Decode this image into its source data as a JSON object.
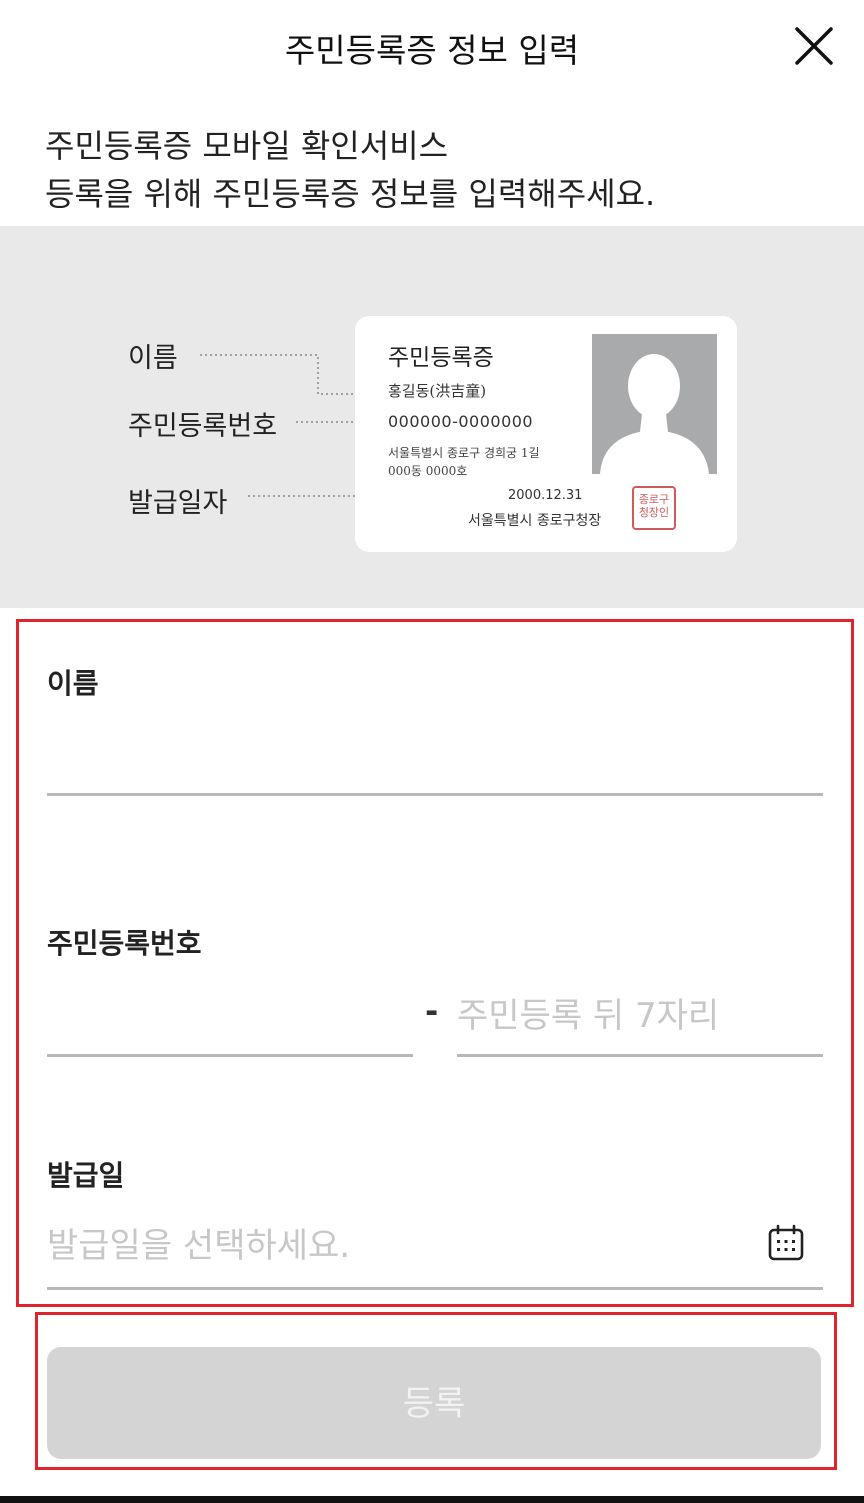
{
  "header": {
    "title": "주민등록증 정보 입력",
    "close_icon": "close-icon"
  },
  "intro": {
    "line1": "주민등록증 모바일 확인서비스",
    "line2": "등록을 위해 주민등록증 정보를 입력해주세요."
  },
  "illustration": {
    "labels": {
      "name": "이름",
      "rrn": "주민등록번호",
      "issue_date": "발급일자"
    },
    "card": {
      "title": "주민등록증",
      "name": "홍길동(洪吉童)",
      "rrn": "000000-0000000",
      "address_line1": "서울특별시 종로구 경희궁 1길",
      "address_line2": "000동 0000호",
      "date": "2000.12.31",
      "issuer": "서울특별시 종로구청장",
      "seal_line1": "종로구",
      "seal_line2": "청장인"
    }
  },
  "form": {
    "name": {
      "label": "이름",
      "value": "",
      "placeholder": ""
    },
    "rrn": {
      "label": "주민등록번호",
      "front_value": "",
      "front_placeholder": "",
      "dash": "-",
      "back_placeholder": "주민등록 뒤 7자리"
    },
    "issue_date": {
      "label": "발급일",
      "placeholder": "발급일을 선택하세요.",
      "icon": "calendar-icon"
    }
  },
  "register_button": {
    "label": "등록",
    "enabled": false
  },
  "colors": {
    "highlight_border": "#e0242c",
    "illustration_bg": "#e9e9ea",
    "button_disabled": "#d4d4d4",
    "placeholder": "#c7c7c7"
  }
}
